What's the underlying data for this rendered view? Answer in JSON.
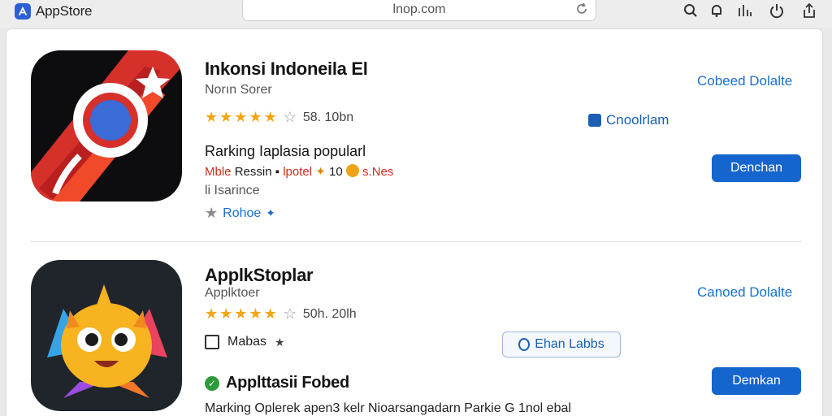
{
  "topbar": {
    "app_name": "AppStore",
    "url": "lnop.com",
    "icons": [
      "search-icon",
      "bell-icon",
      "share-icon",
      "power-icon",
      "upload-icon"
    ]
  },
  "apps": [
    {
      "title": "Inkonsi Indoneila El",
      "subtitle": "Norın Sorer",
      "stars": 5,
      "rating_text": "58. 10bn",
      "section_title": "Rarking Iaplasia popularl",
      "promo_red_1": "Mble",
      "promo_mid": "Ressin",
      "promo_red_2": "lpotel",
      "promo_count": "10",
      "promo_tail": "s.Nes",
      "meta_text": "li Isarince",
      "tag_label": "Rohoe",
      "link_label": "Cobeed Dolalte",
      "side_link_label": "Cnoolrlam",
      "button_label": "Denchan"
    },
    {
      "title": "ApplkStoplar",
      "subtitle": "Applktoer",
      "stars": 5,
      "rating_text": "50h. 20lh",
      "tag_label": "Mabas",
      "section_title": "Applttasii Fobed",
      "footer_text": "Marking Oplerek apen3 kelr Nioarsangadarn Parkie G 1nol ebal",
      "outline_button_label": "Ehan Labbs",
      "link_label": "Canoed Dolalte",
      "button_label": "Demkan"
    }
  ],
  "colors": {
    "accent": "#1565cf",
    "star": "#f2a516",
    "red_text": "#d42b1e"
  }
}
